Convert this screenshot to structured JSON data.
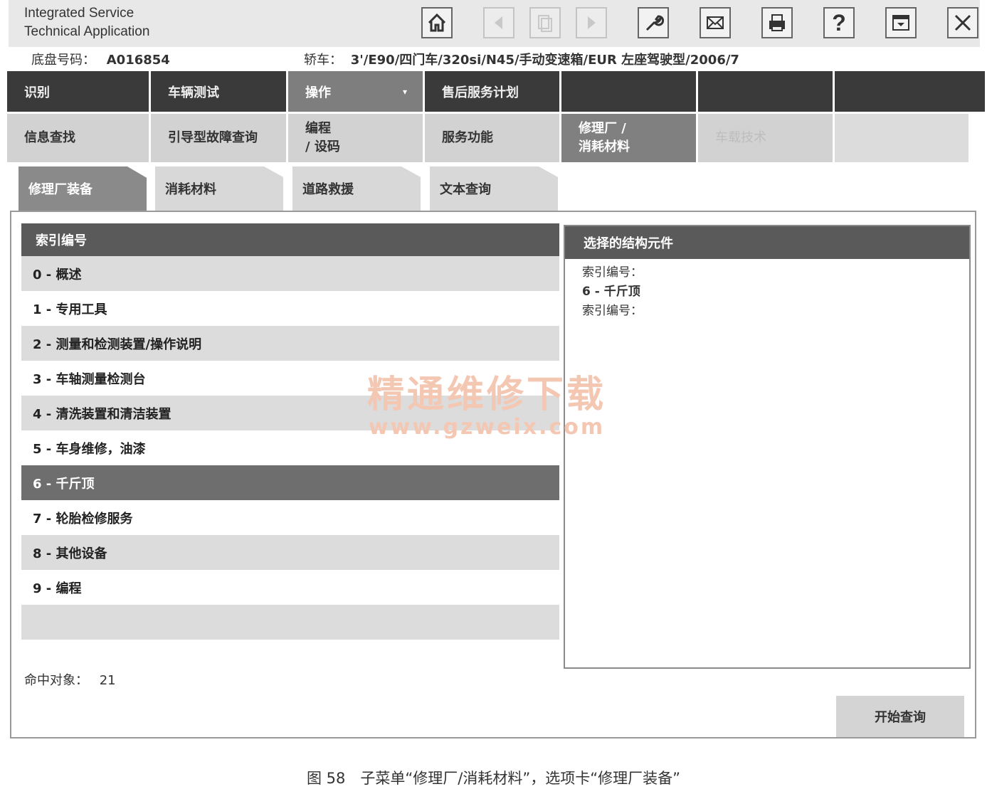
{
  "app": {
    "title_line1": "Integrated Service",
    "title_line2": "Technical Application"
  },
  "toolbar": {
    "buttons": [
      {
        "icon": "home-icon",
        "enabled": true
      },
      {
        "icon": "back-icon",
        "enabled": false
      },
      {
        "icon": "document-icon",
        "enabled": false
      },
      {
        "icon": "forward-icon",
        "enabled": false
      },
      {
        "icon": "wrench-icon",
        "enabled": true
      },
      {
        "icon": "mail-icon",
        "enabled": true
      },
      {
        "icon": "print-icon",
        "enabled": true
      },
      {
        "icon": "help-icon",
        "enabled": true,
        "label": "?"
      },
      {
        "icon": "window-icon",
        "enabled": true
      },
      {
        "icon": "close-icon",
        "enabled": true
      }
    ]
  },
  "vehicle": {
    "chassis_label": "底盘号码：",
    "chassis_value": "A016854",
    "car_label": "轿车：",
    "car_value": "3'/E90/四门车/320si/N45/手动变速箱/EUR 左座驾驶型/2006/7"
  },
  "main_menu": [
    {
      "label": "识别",
      "state": "normal"
    },
    {
      "label": "车辆测试",
      "state": "normal"
    },
    {
      "label": "操作",
      "state": "active"
    },
    {
      "label": "售后服务计划",
      "state": "normal"
    },
    {
      "label": "",
      "state": "normal"
    },
    {
      "label": "",
      "state": "normal"
    },
    {
      "label": "",
      "state": "normal"
    }
  ],
  "sub_menu": [
    {
      "label": "信息查找",
      "state": "normal"
    },
    {
      "label": "引导型故障查询",
      "state": "normal"
    },
    {
      "label": "编程\n/ 设码",
      "state": "normal"
    },
    {
      "label": "服务功能",
      "state": "normal"
    },
    {
      "label": "修理厂 /\n消耗材料",
      "state": "active"
    },
    {
      "label": "车载技术",
      "state": "disabled"
    },
    {
      "label": "",
      "state": "empty"
    }
  ],
  "tabs": [
    {
      "label": "修理厂装备",
      "active": true
    },
    {
      "label": "消耗材料",
      "active": false
    },
    {
      "label": "道路救援",
      "active": false
    },
    {
      "label": "文本查询",
      "active": false
    }
  ],
  "index_list": {
    "header": "索引编号",
    "items": [
      {
        "label": "0 - 概述",
        "style": "shaded"
      },
      {
        "label": "1 - 专用工具",
        "style": "plain"
      },
      {
        "label": "2 - 测量和检测装置/操作说明",
        "style": "shaded"
      },
      {
        "label": "3 - 车轴测量检测台",
        "style": "plain"
      },
      {
        "label": "4 - 清洗装置和清洁装置",
        "style": "shaded"
      },
      {
        "label": "5 - 车身维修，油漆",
        "style": "plain"
      },
      {
        "label": "6 - 千斤顶",
        "style": "selected"
      },
      {
        "label": "7 - 轮胎检修服务",
        "style": "plain"
      },
      {
        "label": "8 - 其他设备",
        "style": "shaded"
      },
      {
        "label": "9 - 编程",
        "style": "plain"
      },
      {
        "label": "",
        "style": "shaded"
      }
    ]
  },
  "component_panel": {
    "header": "选择的结构元件",
    "lines": [
      "索引编号：",
      "6 - 千斤顶",
      "索引编号："
    ]
  },
  "footer": {
    "hit_label": "命中对象：",
    "hit_count": "21",
    "search_button": "开始查询"
  },
  "watermark": {
    "title": "精通维修下载",
    "url": "www.gzweix.com"
  },
  "caption": "图 58　子菜单“修理厂/消耗材料”，选项卡“修理厂装备”"
}
